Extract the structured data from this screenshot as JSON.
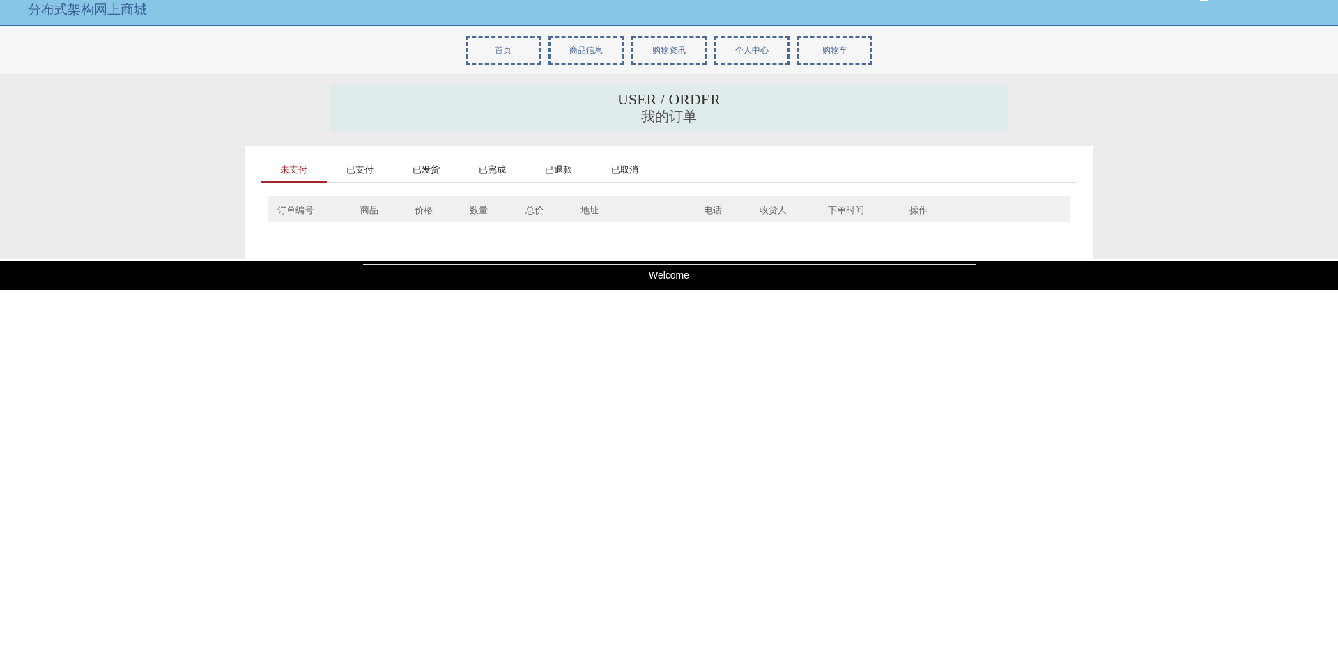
{
  "header": {
    "title": "分布式架构网上商城"
  },
  "nav": [
    {
      "label": "首页"
    },
    {
      "label": "商品信息"
    },
    {
      "label": "购物资讯"
    },
    {
      "label": "个人中心"
    },
    {
      "label": "购物车"
    }
  ],
  "banner": {
    "title": "USER / ORDER",
    "subtitle": "我的订单"
  },
  "tabs": [
    {
      "label": "未支付",
      "selected": true
    },
    {
      "label": "已支付",
      "selected": false
    },
    {
      "label": "已发货",
      "selected": false
    },
    {
      "label": "已完成",
      "selected": false
    },
    {
      "label": "已退款",
      "selected": false
    },
    {
      "label": "已取消",
      "selected": false
    }
  ],
  "table": {
    "columns": [
      "订单编号",
      "商品",
      "价格",
      "数量",
      "总价",
      "地址",
      "电话",
      "收货人",
      "下单时间",
      "操作"
    ]
  },
  "footer": {
    "text": "Welcome"
  }
}
